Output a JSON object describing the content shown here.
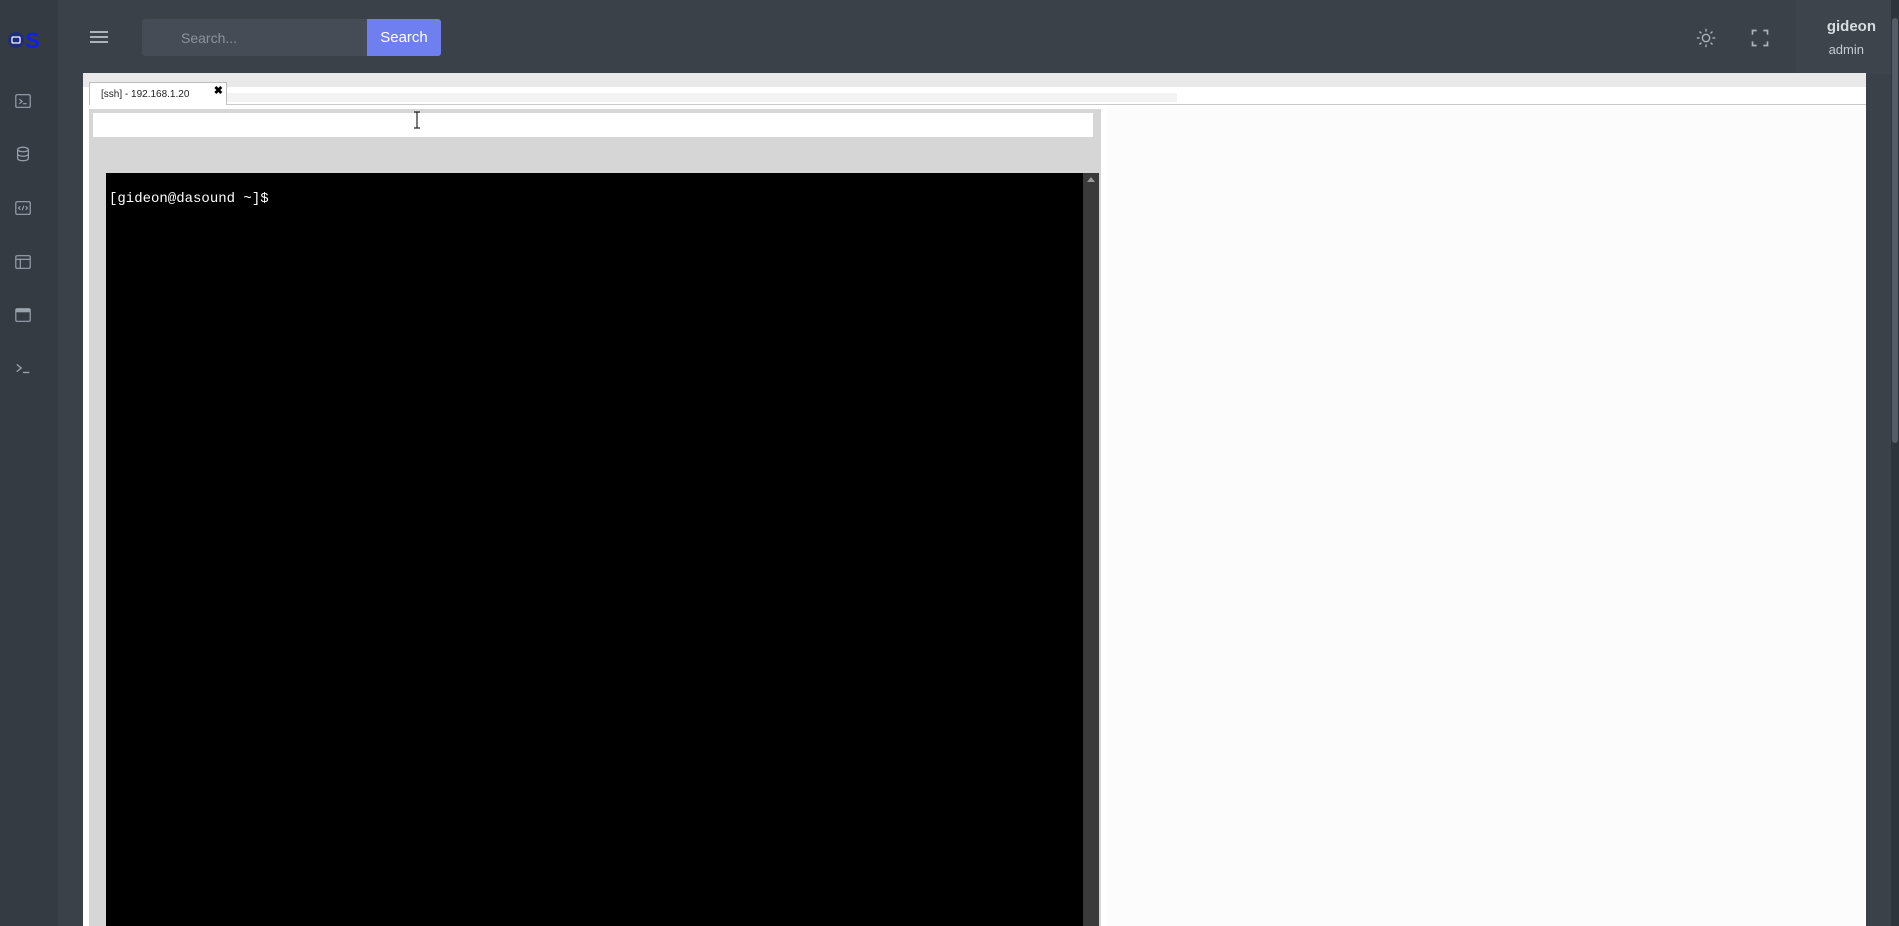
{
  "header": {
    "search": {
      "placeholder": "Search...",
      "button_label": "Search"
    },
    "user": {
      "name": "gideon",
      "role": "admin"
    }
  },
  "sidebar": {
    "items": [
      {
        "icon": "terminal-icon"
      },
      {
        "icon": "database-icon"
      },
      {
        "icon": "code-icon"
      },
      {
        "icon": "layout-icon"
      },
      {
        "icon": "browser-window-icon"
      },
      {
        "icon": "console-prompt-icon"
      }
    ]
  },
  "tabs": [
    {
      "label": "[ssh] - 192.168.1.20",
      "close_glyph": "✖"
    }
  ],
  "terminal": {
    "prompt": "[gideon@dasound ~]$"
  },
  "colors": {
    "header_bg": "#3a4149",
    "sidebar_bg": "#353b43",
    "accent": "#6f7ff0",
    "terminal_bg": "#000000",
    "terminal_fg": "#ffffff"
  }
}
